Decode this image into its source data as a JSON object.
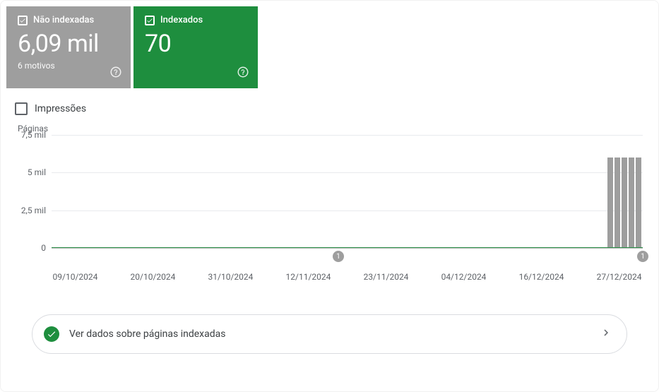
{
  "tiles": {
    "not_indexed": {
      "label": "Não indexadas",
      "value": "6,09 mil",
      "sub": "6 motivos"
    },
    "indexed": {
      "label": "Indexados",
      "value": "70"
    }
  },
  "impressions_label": "Impressões",
  "chart_data": {
    "type": "bar",
    "y_title": "Páginas",
    "ylim": [
      0,
      7500
    ],
    "y_ticks": [
      "7,5 mil",
      "5 mil",
      "2,5 mil",
      "0"
    ],
    "x_ticks": [
      "09/10/2024",
      "20/10/2024",
      "31/10/2024",
      "12/11/2024",
      "23/11/2024",
      "04/12/2024",
      "16/12/2024",
      "27/12/2024"
    ],
    "series": [
      {
        "name": "Não indexadas",
        "color": "#9e9e9e",
        "flat_value_approx": 60,
        "recent_bars": [
          6000,
          6000,
          6000,
          6000,
          6000
        ]
      },
      {
        "name": "Indexados",
        "color": "#1e8e3e",
        "flat_value_approx": 70
      }
    ],
    "markers": [
      {
        "label": "1",
        "x_position_pct": 48.5
      },
      {
        "label": "1",
        "x_position_pct": 100
      }
    ]
  },
  "link_card_text": "Ver dados sobre páginas indexadas"
}
